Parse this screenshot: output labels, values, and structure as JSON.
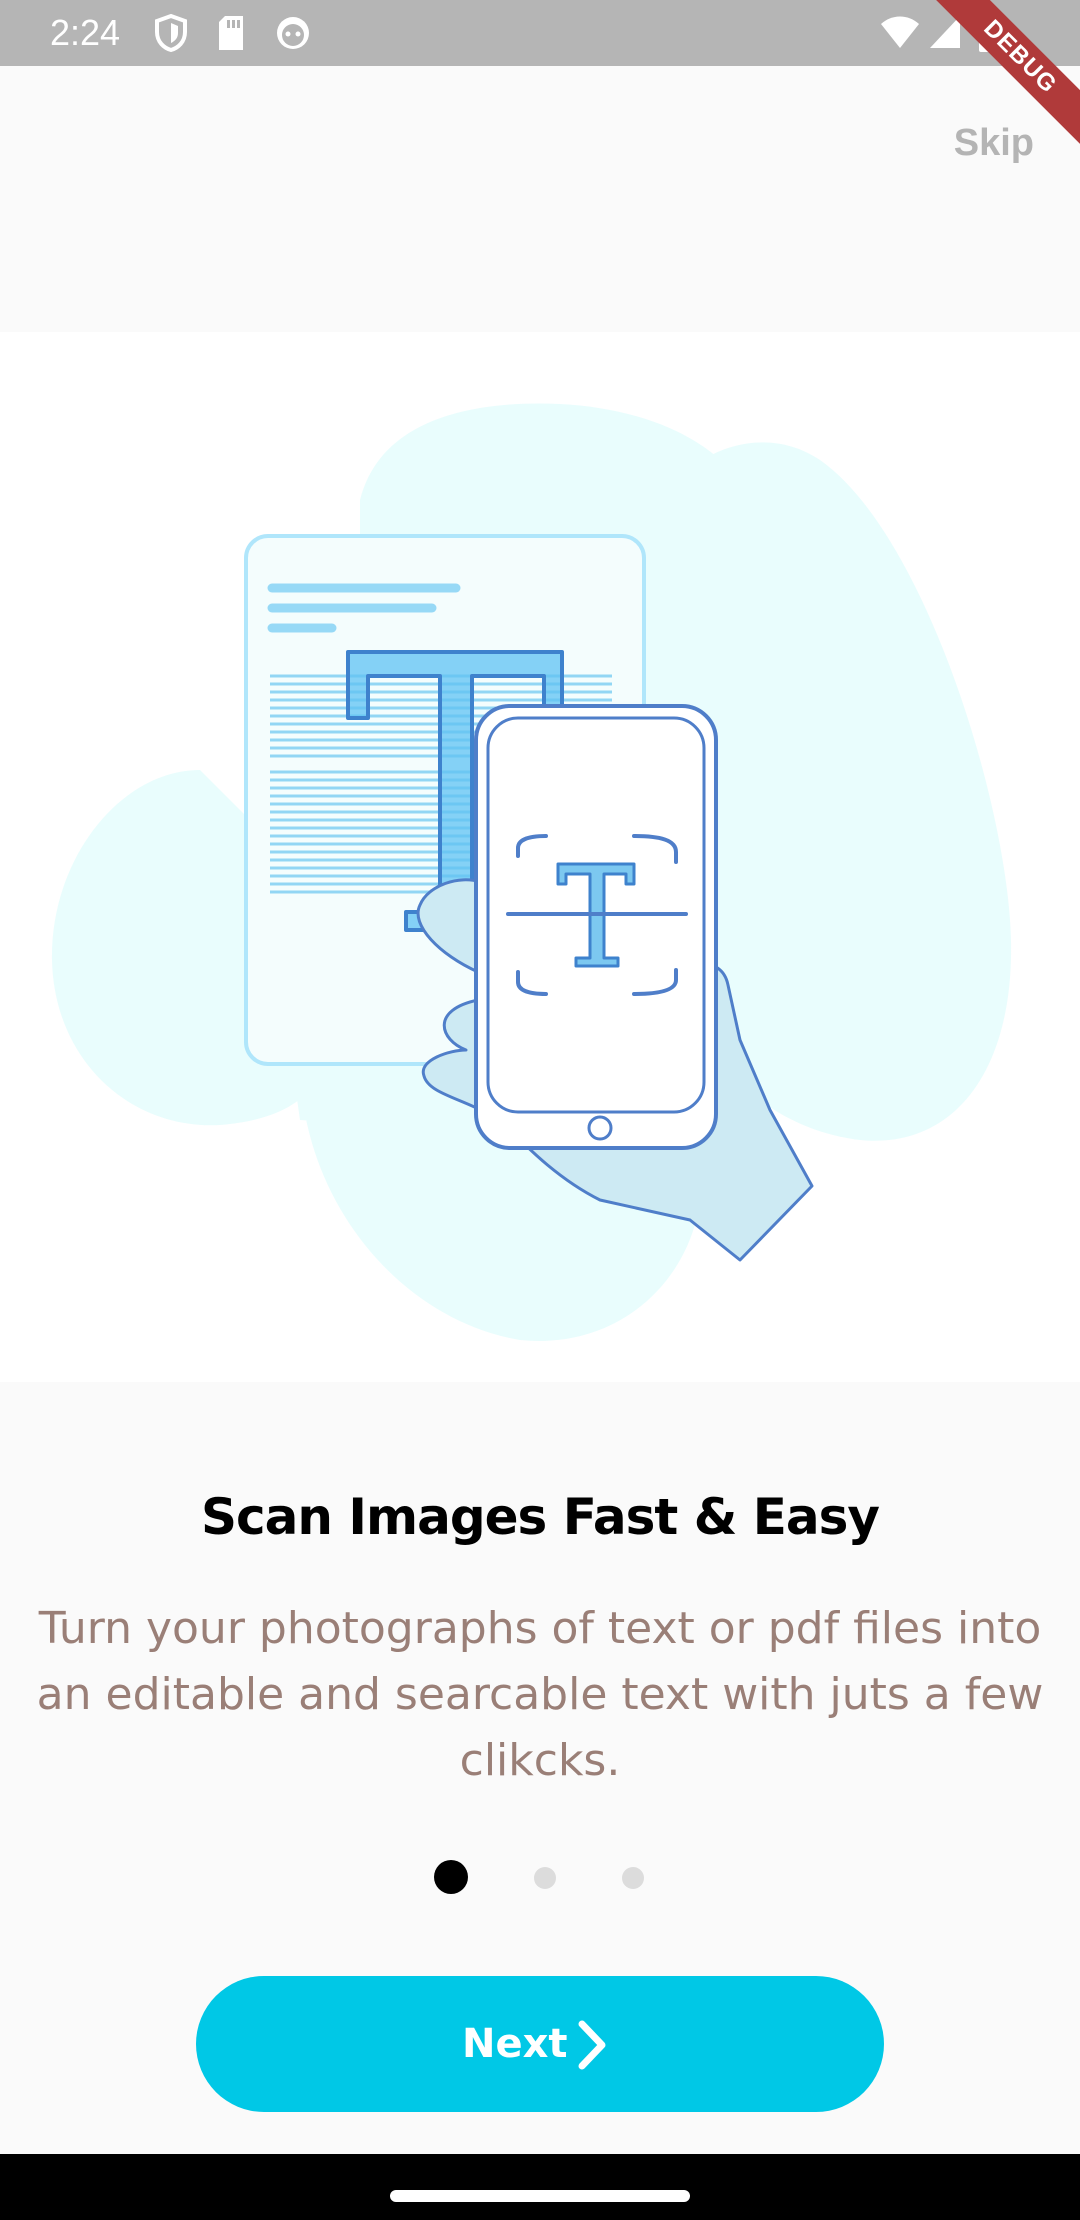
{
  "status_bar": {
    "time": "2:24",
    "icons": [
      "shield-icon",
      "sd-card-icon",
      "android-icon",
      "wifi-icon",
      "signal-icon",
      "battery-icon"
    ]
  },
  "debug_banner": "DEBUG",
  "header": {
    "skip_label": "Skip"
  },
  "onboarding": {
    "title": "Scan Images Fast & Easy",
    "description": "Turn your photographs of text or pdf files into an editable and searcable text with juts a few clikcks.",
    "current_page": 1,
    "total_pages": 3
  },
  "next_button": {
    "label": "Next",
    "icon": "chevron-right-icon"
  },
  "colors": {
    "accent": "#00c8e6",
    "description_text": "#9a7f77",
    "skip_text": "#b4b4b4",
    "blob": "#e8fdfd",
    "line_art": "#4f7ec9"
  }
}
